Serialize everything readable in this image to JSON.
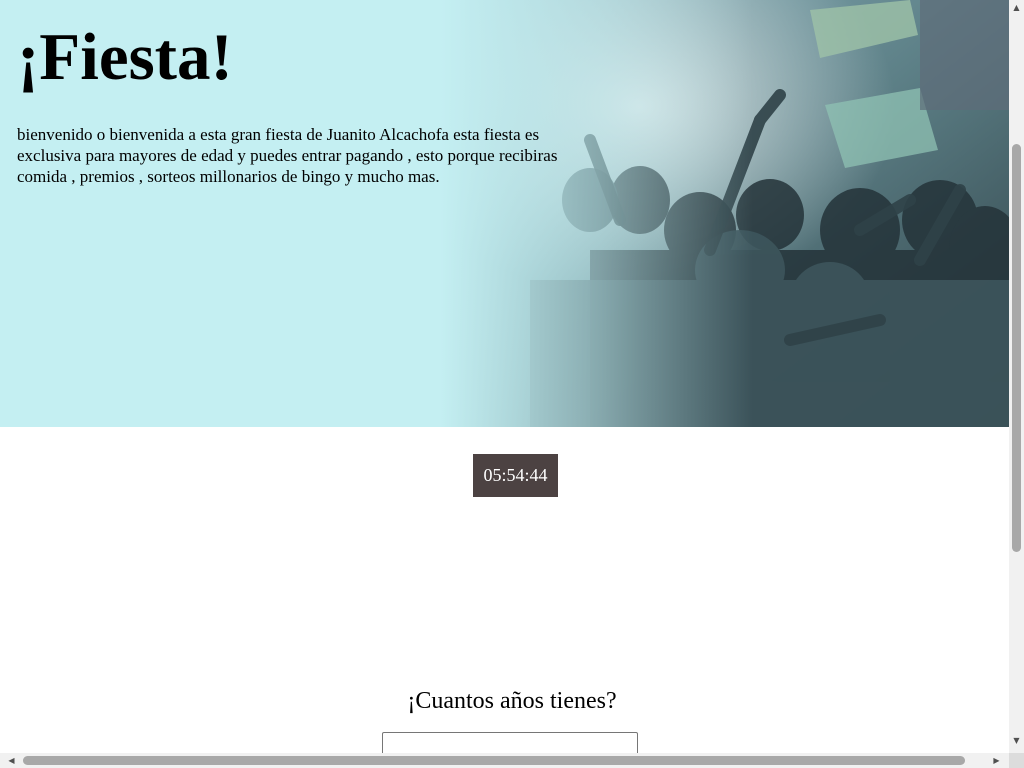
{
  "hero": {
    "title": "¡Fiesta!",
    "description": "bienvenido o bienvenida a esta gran fiesta de Juanito Alcachofa esta fiesta es exclusiva para mayores de edad y puedes entrar pagando , esto porque recibiras comida , premios , sorteos millonarios de bingo y mucho mas.",
    "image": "party-crowd-photo",
    "background_color": "#c4eff2"
  },
  "timer": {
    "value": "05:54:44",
    "background_color": "#4c4242"
  },
  "age_form": {
    "question": "¡Cuantos años tienes?",
    "input_value": ""
  },
  "scrollbars": {
    "vertical": {
      "up_icon": "arrow-up-icon",
      "down_icon": "arrow-down-icon"
    },
    "horizontal": {
      "left_icon": "arrow-left-icon",
      "right_icon": "arrow-right-icon"
    }
  }
}
